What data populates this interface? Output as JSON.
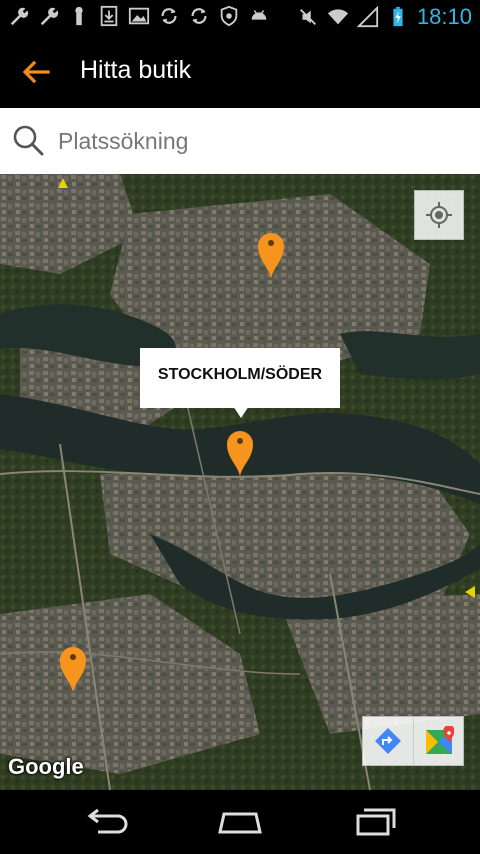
{
  "status_bar": {
    "time": "18:10",
    "left_icons": [
      "wrench-icon",
      "wrench-icon",
      "usb-debug-icon",
      "download-icon",
      "image-icon",
      "sync-icon",
      "sync-icon",
      "shield-icon",
      "android-icon"
    ],
    "right_icons": [
      "mute-icon",
      "wifi-icon",
      "signal-icon",
      "battery-charging-icon"
    ],
    "clock_color": "#33b5e5"
  },
  "header": {
    "title": "Hitta butik",
    "back_color": "#f28c1c"
  },
  "search": {
    "placeholder": "Platssökning",
    "value": ""
  },
  "map": {
    "info_window_label": "STOCKHOLM/SÖDER",
    "marker_color": "#f7941d",
    "attribution": "Google",
    "markers": [
      "store-marker-north",
      "store-marker-soder",
      "store-marker-southwest"
    ]
  },
  "nav": {
    "buttons": [
      "back",
      "home",
      "recent-apps"
    ]
  }
}
